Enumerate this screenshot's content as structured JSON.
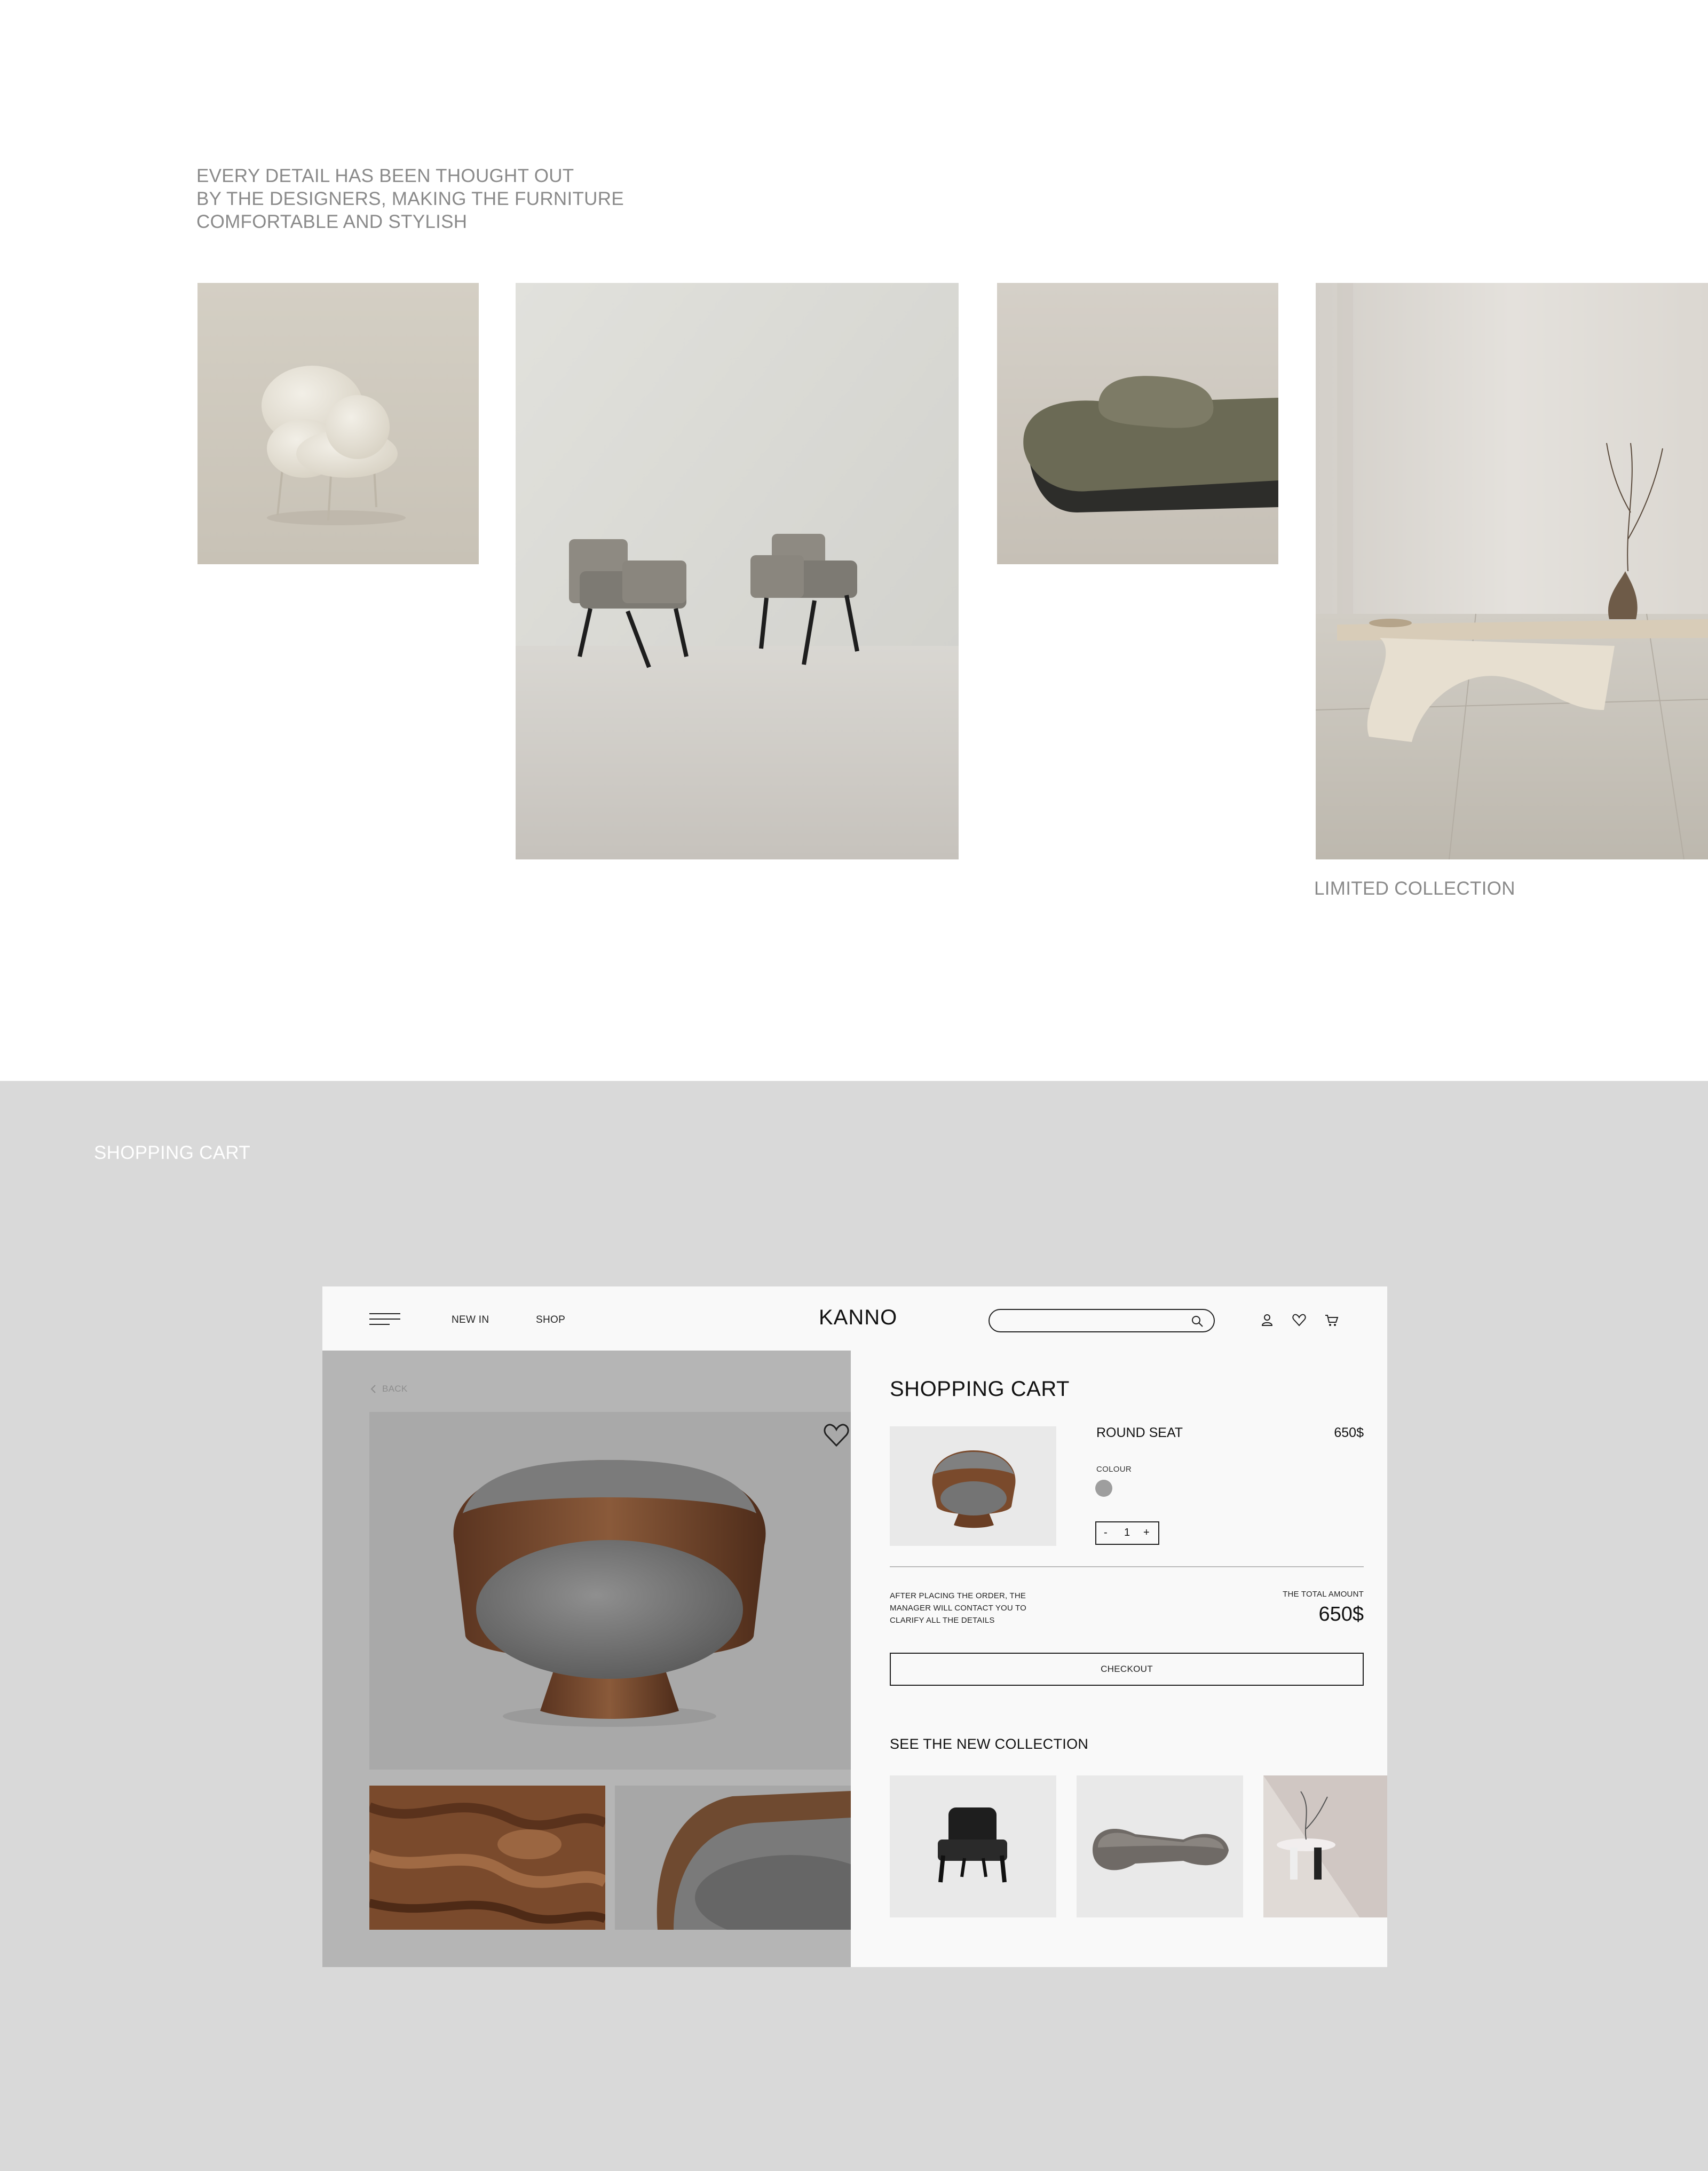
{
  "intro_text": [
    "EVERY DETAIL HAS BEEN THOUGHT OUT",
    "BY THE DESIGNERS, MAKING THE FURNITURE",
    "COMFORTABLE AND STYLISH"
  ],
  "limited_caption": "LIMITED COLLECTION",
  "cart_section_caption": "SHOPPING CART",
  "mockup": {
    "nav": {
      "new_in": "NEW IN",
      "shop": "SHOP"
    },
    "logo": "KANNO",
    "search": {
      "placeholder": ""
    },
    "back_label": "BACK",
    "cart_title": "SHOPPING CART",
    "item": {
      "name": "ROUND SEAT",
      "price": "650$",
      "colour_label": "COLOUR",
      "colour": "#9e9e9e",
      "quantity": "1",
      "minus": "-",
      "plus": "+"
    },
    "note": "AFTER PLACING THE ORDER, THE MANAGER WILL CONTACT YOU TO CLARIFY ALL THE DETAILS",
    "total_label": "THE TOTAL AMOUNT",
    "total": "650$",
    "checkout_label": "CHECKOUT",
    "collection_title": "SEE THE NEW COLLECTION"
  },
  "colors": {
    "page_bg": "#ffffff",
    "section_bg": "#d9d9d9",
    "mock_bg": "#f9f9f9",
    "product_bg": "#b5b5b5",
    "text_grey": "#8a8a8a",
    "text_dark": "#111111"
  },
  "icons": [
    "menu-icon",
    "search-icon",
    "user-icon",
    "heart-icon",
    "cart-icon",
    "chevron-left-icon"
  ]
}
